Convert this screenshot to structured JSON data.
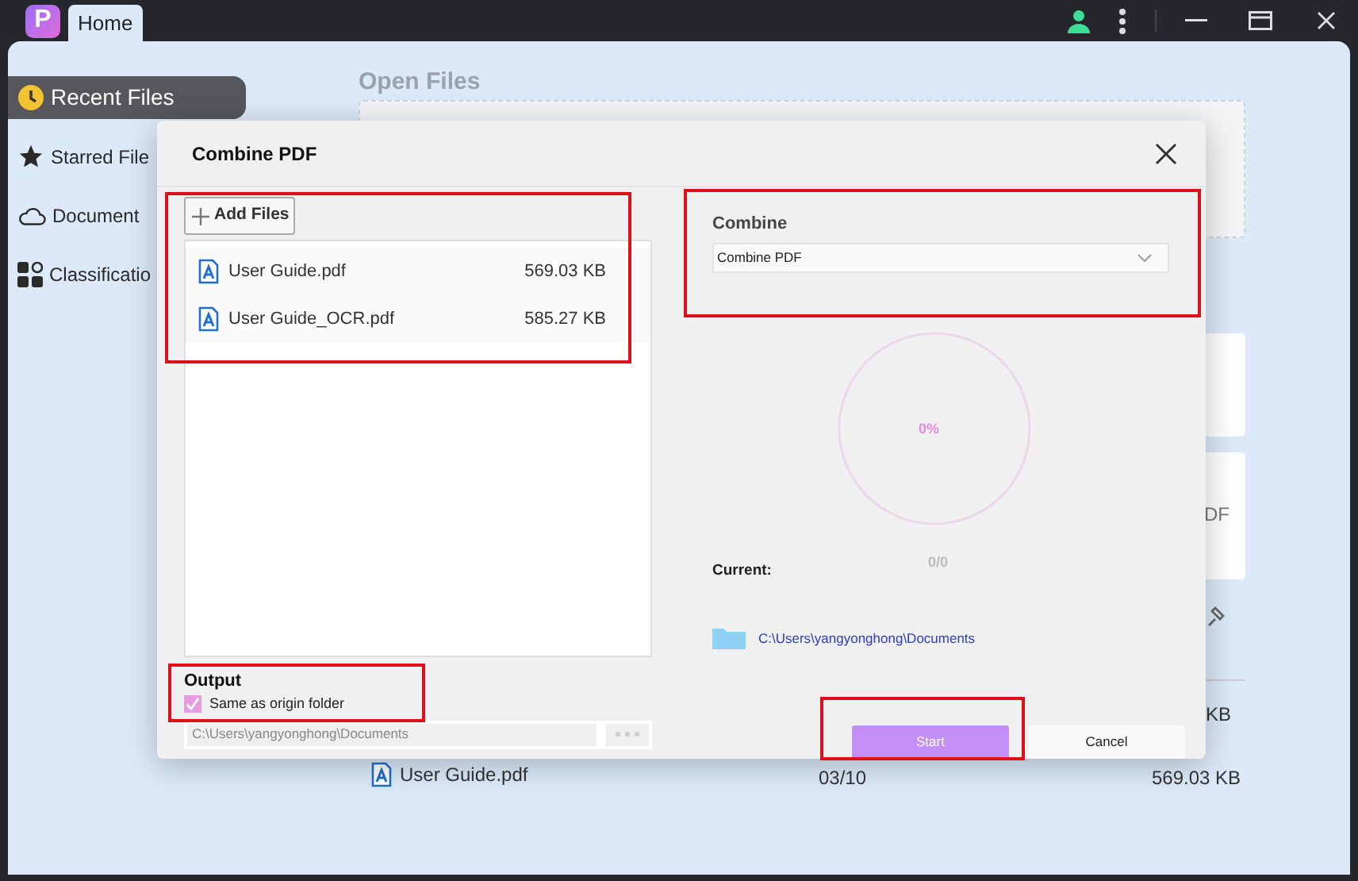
{
  "app": {
    "logo": "P",
    "tab": "Home"
  },
  "sidebar": {
    "items": [
      {
        "label": "Recent Files",
        "selected": true
      },
      {
        "label": "Starred File",
        "selected": false
      },
      {
        "label": "Document",
        "selected": false
      },
      {
        "label": "Classificatio",
        "selected": false
      }
    ]
  },
  "background": {
    "heading": "Open Files",
    "card_text": "DF",
    "size_text": "KB",
    "row": {
      "name": "User Guide.pdf",
      "date": "03/10",
      "size": "569.03 KB"
    }
  },
  "dialog": {
    "title": "Combine PDF",
    "add_files": "Add Files",
    "files": [
      {
        "name": "User Guide.pdf",
        "size": "569.03 KB"
      },
      {
        "name": "User Guide_OCR.pdf",
        "size": "585.27 KB"
      }
    ],
    "output": {
      "label": "Output",
      "same_as_origin": {
        "label": "Same as origin folder",
        "checked": true
      },
      "path": "C:\\Users\\yangyonghong\\Documents"
    },
    "combine": {
      "label": "Combine",
      "value": "Combine PDF"
    },
    "progress": {
      "percent": "0%",
      "level": 0,
      "count": "0/0"
    },
    "current": {
      "label": "Current:",
      "folder": "C:\\Users\\yangyonghong\\Documents"
    },
    "buttons": [
      {
        "label": "Start",
        "kind": "primary"
      },
      {
        "label": "Cancel",
        "kind": "secondary"
      }
    ]
  }
}
